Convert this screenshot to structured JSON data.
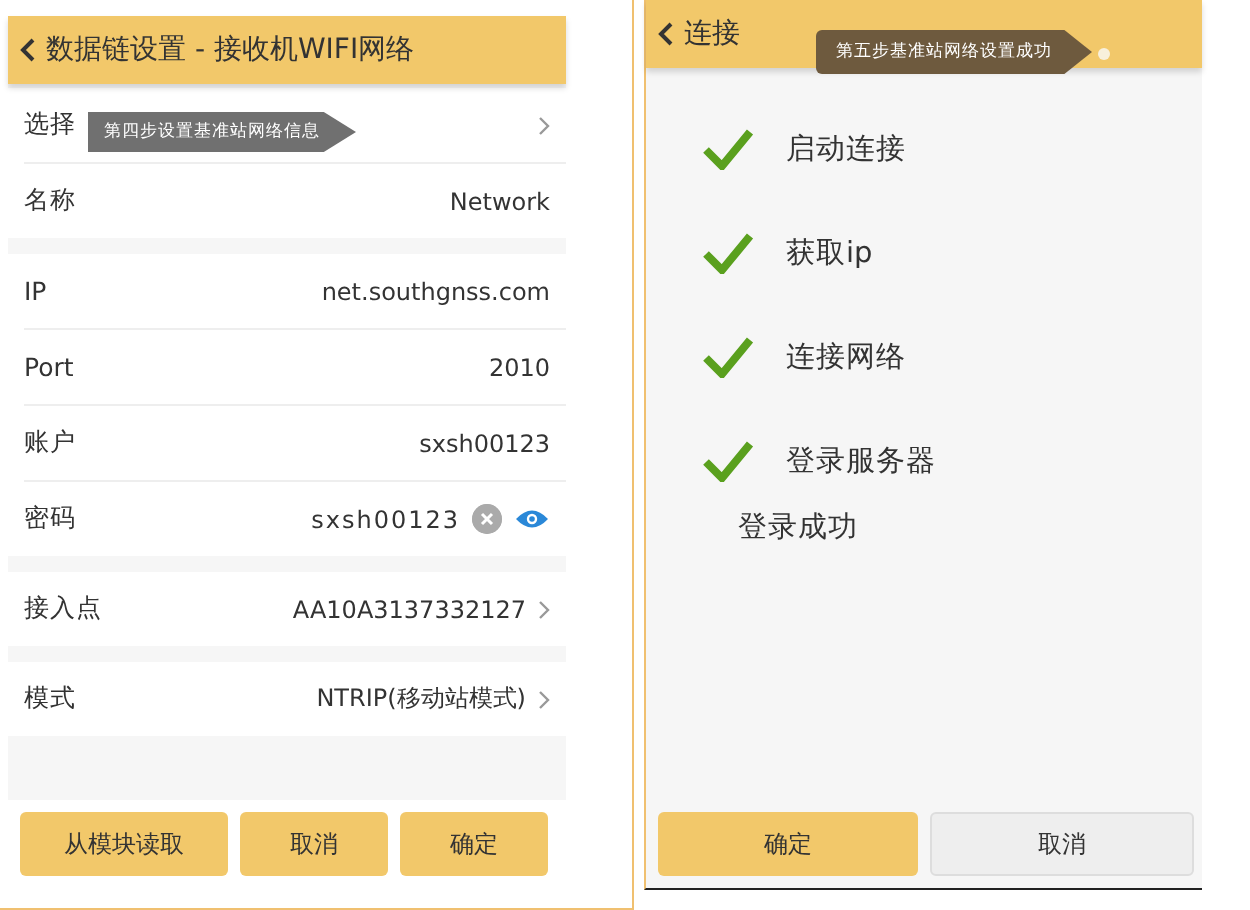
{
  "left": {
    "title": "数据链设置 - 接收机WIFI网络",
    "tooltip": "第四步设置基准站网络信息",
    "groups": [
      [
        {
          "label": "选择",
          "kind": "link"
        },
        {
          "label": "名称",
          "value": "Network",
          "kind": "text"
        }
      ],
      [
        {
          "label": "IP",
          "value": "net.southgnss.com",
          "kind": "text"
        },
        {
          "label": "Port",
          "value": "2010",
          "kind": "text"
        },
        {
          "label": "账户",
          "value": "sxsh00123",
          "kind": "text"
        },
        {
          "label": "密码",
          "value": "sxsh00123",
          "kind": "password"
        }
      ],
      [
        {
          "label": "接入点",
          "value": "AA10A3137332127",
          "kind": "link"
        }
      ],
      [
        {
          "label": "模式",
          "value": "NTRIP(移动站模式)",
          "kind": "link"
        }
      ]
    ],
    "buttons": [
      {
        "label": "从模块读取",
        "primary": true
      },
      {
        "label": "取消",
        "primary": true
      },
      {
        "label": "确定",
        "primary": true
      }
    ]
  },
  "right": {
    "title": "连接",
    "tooltip": "第五步基准站网络设置成功",
    "steps": [
      {
        "label": "启动连接",
        "done": true
      },
      {
        "label": "获取ip",
        "done": true
      },
      {
        "label": "连接网络",
        "done": true
      },
      {
        "label": "登录服务器",
        "done": true
      }
    ],
    "result": "登录成功",
    "buttons": [
      {
        "label": "确定",
        "primary": true
      },
      {
        "label": "取消",
        "primary": false
      }
    ]
  }
}
